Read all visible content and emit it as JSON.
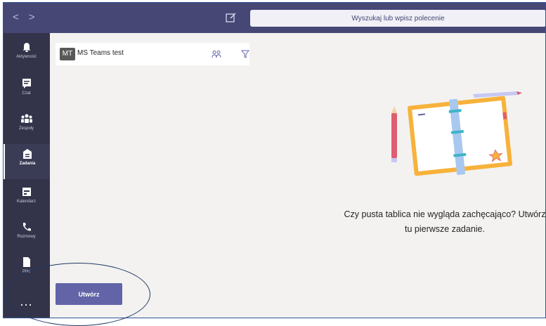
{
  "app": {
    "name": "Microsoft Teams"
  },
  "titlebar": {
    "back_icon": "chevron-left-icon",
    "forward_icon": "chevron-right-icon",
    "compose_icon": "compose-icon",
    "search_placeholder": "Wyszukaj lub wpisz polecenie",
    "colors": {
      "bar": "#464775",
      "search_bg": "#f0f0f6"
    }
  },
  "rail": {
    "items": [
      {
        "label": "Aktywność",
        "icon": "bell-icon"
      },
      {
        "label": "Czat",
        "icon": "chat-icon"
      },
      {
        "label": "Zespoły",
        "icon": "teams-icon"
      },
      {
        "label": "Zadania",
        "icon": "assignments-icon",
        "active": true
      },
      {
        "label": "Kalendarz",
        "icon": "calendar-icon"
      },
      {
        "label": "Rozmowy",
        "icon": "phone-icon"
      },
      {
        "label": "Pliki",
        "icon": "file-icon"
      }
    ],
    "more": "...",
    "colors": {
      "bg": "#33344a"
    }
  },
  "header": {
    "team_initials": "MT",
    "team_name": "MS Teams test",
    "group_icon": "people-icon",
    "filter_icon": "filter-icon"
  },
  "main": {
    "empty_state_icon": "notebook-illustration",
    "empty_message": "Czy pusta tablica nie wygląda zachęcająco? Utwórz tu pierwsze zadanie.",
    "create_button": "Utwórz",
    "colors": {
      "accent": "#6264a7"
    }
  }
}
